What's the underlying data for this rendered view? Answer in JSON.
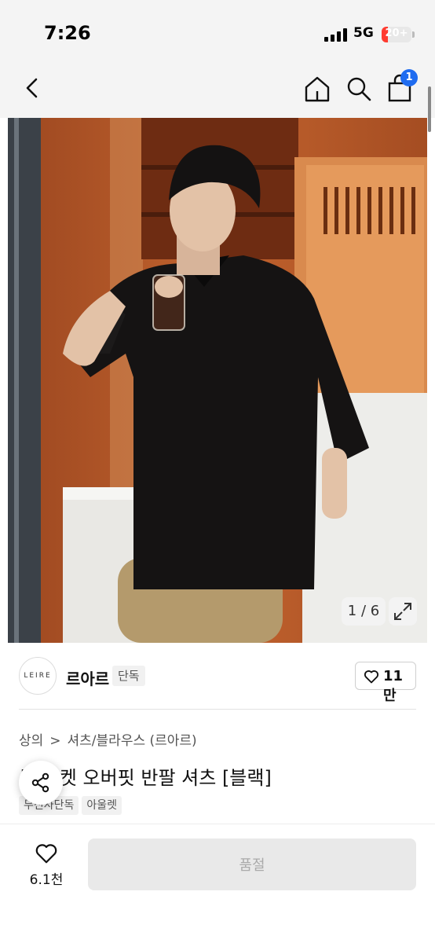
{
  "status_bar": {
    "time": "7:26",
    "network": "5G",
    "battery_label": "20+",
    "battery_level_percent": 20,
    "battery_color": "#ff3b30"
  },
  "header": {
    "cart_count": "1",
    "badge_color": "#1f6cf0",
    "icons": [
      "back-chevron-icon",
      "home-icon",
      "search-icon",
      "shopping-bag-icon"
    ]
  },
  "gallery": {
    "counter": "1 / 6",
    "expand_icon": "expand-arrows-icon"
  },
  "brand": {
    "logo_text": "LEIRE",
    "name": "르아르",
    "exclusive_tag": "단독",
    "likes": "11만"
  },
  "breadcrumb": {
    "items": [
      "상의",
      "셔츠/블라우스 (르아르)"
    ],
    "separator": ">"
  },
  "product": {
    "title": "투 포켓 오버핏 반팔 셔츠 [블랙]",
    "tags": [
      "무신사단독",
      "아울렛"
    ]
  },
  "bottom_bar": {
    "wish_count": "6.1천",
    "buy_label": "품절"
  }
}
